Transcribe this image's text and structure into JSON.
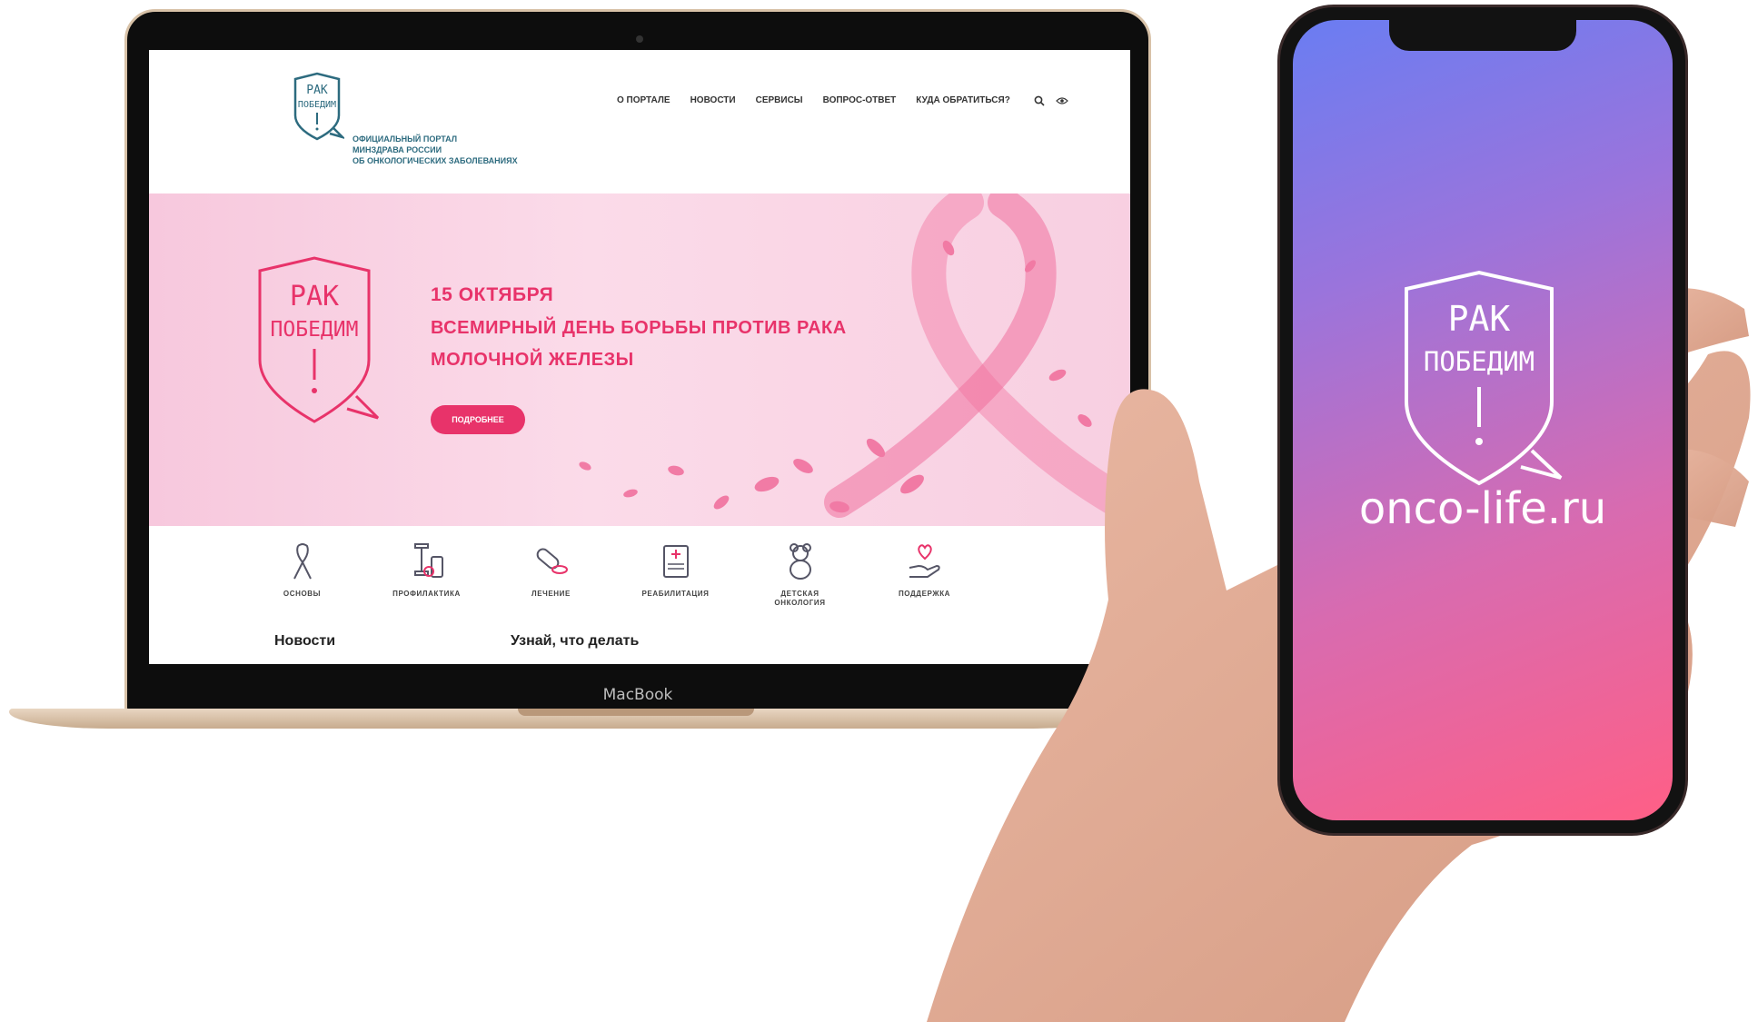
{
  "laptop": {
    "brand": "MacBook"
  },
  "site": {
    "logo": {
      "line1": "РАК",
      "line2": "ПОБЕДИМ"
    },
    "tagline": [
      "ОФИЦИАЛЬНЫЙ ПОРТАЛ",
      "МИНЗДРАВА РОССИИ",
      "ОБ ОНКОЛОГИЧЕСКИХ ЗАБОЛЕВАНИЯХ"
    ],
    "nav": [
      "О ПОРТАЛЕ",
      "НОВОСТИ",
      "СЕРВИСЫ",
      "ВОПРОС-ОТВЕТ",
      "КУДА ОБРАТИТЬСЯ?"
    ],
    "icons": {
      "search": "search-icon",
      "accessibility": "eye-icon"
    },
    "hero": {
      "date": "15 ОКТЯБРЯ",
      "line1": "ВСЕМИРНЫЙ ДЕНЬ БОРЬБЫ ПРОТИВ РАКА",
      "line2": "МОЛОЧНОЙ ЖЕЛЕЗЫ",
      "button": "ПОДРОБНЕЕ",
      "accent": "#e8336a"
    },
    "categories": [
      {
        "label": "ОСНОВЫ",
        "icon": "ribbon-icon"
      },
      {
        "label": "ПРОФИЛАКТИКА",
        "icon": "dumbbell-icon"
      },
      {
        "label": "ЛЕЧЕНИЕ",
        "icon": "pill-icon"
      },
      {
        "label": "РЕАБИЛИТАЦИЯ",
        "icon": "medical-document-icon"
      },
      {
        "label": "ДЕТСКАЯ ОНКОЛОГИЯ",
        "icon": "teddy-bear-icon"
      },
      {
        "label": "ПОДДЕРЖКА",
        "icon": "heart-hand-icon"
      }
    ],
    "sections": {
      "news": "Новости",
      "learn": "Узнай, что делать"
    }
  },
  "phone": {
    "logo": {
      "line1": "РАК",
      "line2": "ПОБЕДИМ"
    },
    "url": "onco-life.ru"
  }
}
